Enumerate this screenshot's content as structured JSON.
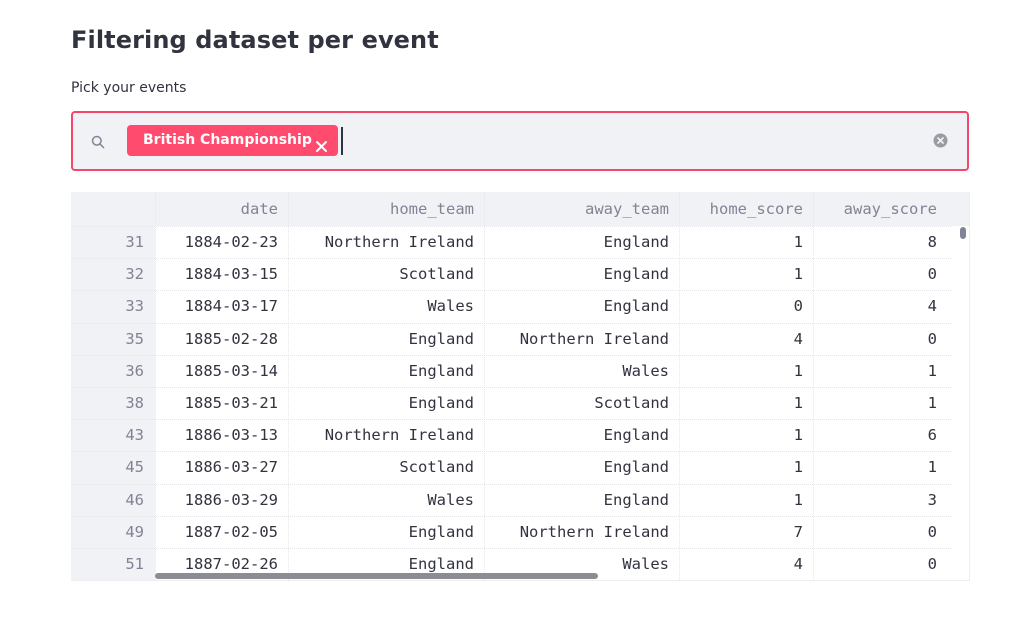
{
  "page": {
    "title": "Filtering dataset per event"
  },
  "filter": {
    "label": "Pick your events",
    "selected": [
      "British Championship"
    ],
    "icons": {
      "search": "search-icon",
      "remove_tag": "close-icon",
      "clear": "clear-circle-icon"
    },
    "accent_color": "#ff4b6e",
    "border_color": "#f3476c"
  },
  "table": {
    "columns": [
      "date",
      "home_team",
      "away_team",
      "home_score",
      "away_score"
    ],
    "rows": [
      {
        "index": "31",
        "cells": [
          "1884-02-23",
          "Northern Ireland",
          "England",
          "1",
          "8"
        ]
      },
      {
        "index": "32",
        "cells": [
          "1884-03-15",
          "Scotland",
          "England",
          "1",
          "0"
        ]
      },
      {
        "index": "33",
        "cells": [
          "1884-03-17",
          "Wales",
          "England",
          "0",
          "4"
        ]
      },
      {
        "index": "35",
        "cells": [
          "1885-02-28",
          "England",
          "Northern Ireland",
          "4",
          "0"
        ]
      },
      {
        "index": "36",
        "cells": [
          "1885-03-14",
          "England",
          "Wales",
          "1",
          "1"
        ]
      },
      {
        "index": "38",
        "cells": [
          "1885-03-21",
          "England",
          "Scotland",
          "1",
          "1"
        ]
      },
      {
        "index": "43",
        "cells": [
          "1886-03-13",
          "Northern Ireland",
          "England",
          "1",
          "6"
        ]
      },
      {
        "index": "45",
        "cells": [
          "1886-03-27",
          "Scotland",
          "England",
          "1",
          "1"
        ]
      },
      {
        "index": "46",
        "cells": [
          "1886-03-29",
          "Wales",
          "England",
          "1",
          "3"
        ]
      },
      {
        "index": "49",
        "cells": [
          "1887-02-05",
          "England",
          "Northern Ireland",
          "7",
          "0"
        ]
      },
      {
        "index": "51",
        "cells": [
          "1887-02-26",
          "England",
          "Wales",
          "4",
          "0"
        ]
      }
    ]
  }
}
